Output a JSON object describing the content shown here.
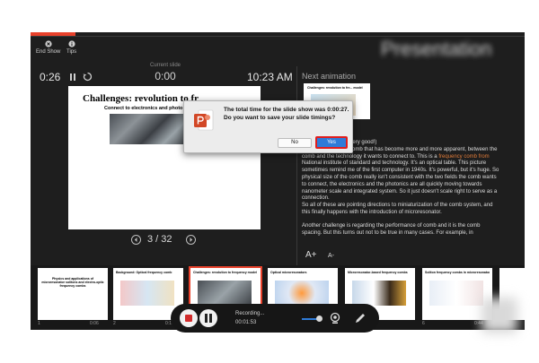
{
  "toolbar": {
    "end_show_label": "End Show",
    "tips_label": "Tips",
    "blurred_title": "Presentation"
  },
  "timers": {
    "elapsed": "0:26",
    "current_slide_label": "Current slide",
    "current_slide_time": "0:00",
    "clock": "10:23 AM"
  },
  "slide": {
    "title": "Challenges: revolution to fr",
    "subtitle": "Connect to electronics and photo",
    "counter": "3 / 32"
  },
  "next": {
    "label": "Next animation",
    "thumb_title": "Challenges: revolution to fre... model"
  },
  "notes": {
    "line1": "(I know why but not very good!)",
    "line2a": "...ges for frequency comb that has become more and more apparent, ",
    "line2b": "between the comb and the technology it wants to connect to. This is a ",
    "hl1": "frequency comb from",
    "line2c": " National institute of standard and technology. It's an optical table. This picture sometimes remind me of the first computer in 1940s. It's powerful, but it's huge. So physical size of the comb really isn't consistent with the two fields the comb wants to connect, the electronics and the photonics are all quickly moving towards nanometer scale and integrated system. So it just doesn't scale right to serve as a connection.",
    "line3": "So all of these are pointing directions to miniaturization of the comb system, and this finally happens with the introduction of microresonator.",
    "line4": "Another challenge is regarding the performance of comb and it is the comb spacing. But this turns out not to be true in many cases. For example, in",
    "font_up": "A+",
    "font_down": "A-"
  },
  "filmstrip": [
    {
      "num": "1",
      "time": "0:06",
      "title": "Physics and applications of microresonator solitons and electro-optic frequency combs"
    },
    {
      "num": "2",
      "time": "0:10",
      "title": "Background: Optical frequency comb"
    },
    {
      "num": "3",
      "time": "",
      "title": "Challenges: revolution to frequency model"
    },
    {
      "num": "4",
      "time": "",
      "title": "Optical microresonators"
    },
    {
      "num": "5",
      "time": "",
      "title": "Microresonator-based frequency combs"
    },
    {
      "num": "6",
      "time": "0:44",
      "title": "Soliton frequency combs in microresonators"
    }
  ],
  "dialog": {
    "message": "The total time for the slide show was 0:00:27. Do you want to save your slide timings?",
    "no_label": "No",
    "yes_label": "Yes"
  },
  "recording": {
    "label": "Recording...",
    "time": "00:01:53"
  },
  "colors": {
    "accent_red": "#e8412b",
    "dialog_blue": "#2f7bd8",
    "highlight_orange": "#e07b39"
  }
}
